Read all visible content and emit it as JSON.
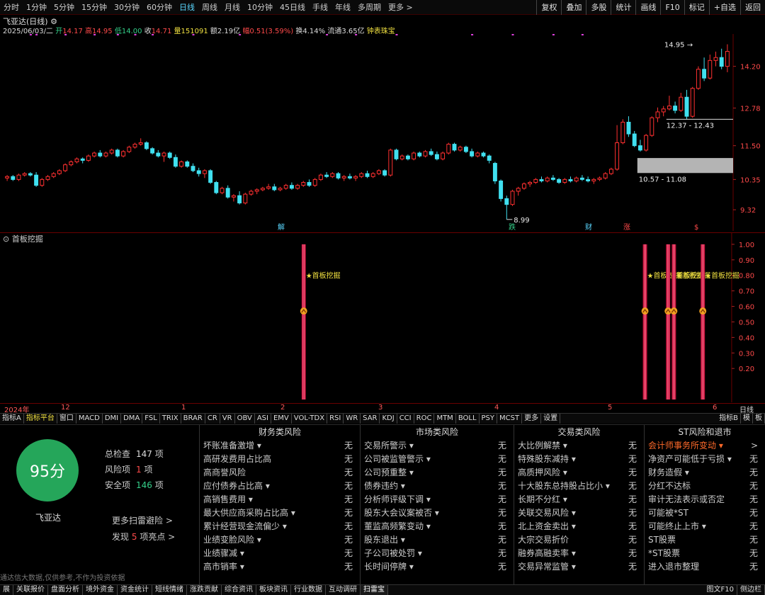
{
  "periods": [
    "分时",
    "1分钟",
    "5分钟",
    "15分钟",
    "30分钟",
    "60分钟",
    "日线",
    "周线",
    "月线",
    "10分钟",
    "45日线",
    "手线",
    "年线",
    "多周期",
    "更多 >"
  ],
  "period_active": "日线",
  "toolbar_right": [
    "复权",
    "叠加",
    "多股",
    "统计",
    "画线",
    "F10",
    "标记",
    "+自选",
    "返回"
  ],
  "title": "飞亚达(日线)",
  "quote": {
    "date": "2025/06/03/二",
    "open_label": "开",
    "open": "14.17",
    "high_label": "高",
    "high": "14.95",
    "low_label": "低",
    "low": "14.00",
    "close_label": "收",
    "close": "14.71",
    "vol_label": "量",
    "vol": "151091",
    "amt_label": "额",
    "amt": "2.19亿",
    "chg_label": "幅",
    "chg": "0.51(3.59%)",
    "turn_label": "换",
    "turn": "4.14%",
    "float_label": "流通",
    "float": "3.65亿",
    "extra": "钟表珠宝"
  },
  "price_axis": [
    "14.20",
    "12.78",
    "11.50",
    "10.35",
    "9.32"
  ],
  "annotations": {
    "high_mark": "14.95",
    "low_mark": "8.99",
    "zone1": "12.37 - 12.43",
    "zone2": "10.57 - 11.08"
  },
  "event_tags": [
    "解",
    "跌",
    "财",
    "涨",
    "$"
  ],
  "indicator": {
    "title": "首板挖掘",
    "axis": [
      "1.00",
      "0.90",
      "0.80",
      "0.70",
      "0.60",
      "0.50",
      "0.40",
      "0.30",
      "0.20"
    ],
    "signal_label": "★首板挖掘"
  },
  "time_axis": [
    "2024年",
    "12",
    "1",
    "2",
    "3",
    "4",
    "5",
    "6"
  ],
  "time_axis_right": "日线",
  "tabs": [
    "指标A",
    "指标平台",
    "窗口",
    "MACD",
    "DMI",
    "DMA",
    "FSL",
    "TRIX",
    "BRAR",
    "CR",
    "VR",
    "OBV",
    "ASI",
    "EMV",
    "VOL-TDX",
    "RSI",
    "WR",
    "SAR",
    "KDJ",
    "CCI",
    "ROC",
    "MTM",
    "BOLL",
    "PSY",
    "MCST",
    "更多",
    "设置"
  ],
  "tabs_right": [
    "指标B",
    "模",
    "板"
  ],
  "score": {
    "value": "95分",
    "name": "飞亚达",
    "total_label": "总检查",
    "total": "147",
    "total_unit": "项",
    "risk_label": "风险项",
    "risk": "1",
    "risk_unit": "项",
    "safe_label": "安全项",
    "safe": "146",
    "safe_unit": "项",
    "more": "更多扫雷避险 >",
    "found_pre": "发现",
    "found": "5",
    "found_post": "项亮点 >",
    "disclaimer": "通达信大数据,仅供参考,不作为投资依据"
  },
  "columns": [
    {
      "title": "财务类风险",
      "rows": [
        {
          "label": "坏账准备激增 ▾",
          "value": "无"
        },
        {
          "label": "高研发费用占比高",
          "value": "无"
        },
        {
          "label": "高商誉风险",
          "value": "无"
        },
        {
          "label": "应付债券占比高 ▾",
          "value": "无"
        },
        {
          "label": "高销售费用 ▾",
          "value": "无"
        },
        {
          "label": "最大供应商采购占比高 ▾",
          "value": "无"
        },
        {
          "label": "累计经营现金流偏少 ▾",
          "value": "无"
        },
        {
          "label": "业绩变脸风险 ▾",
          "value": "无"
        },
        {
          "label": "业绩骤减 ▾",
          "value": "无"
        },
        {
          "label": "高市销率 ▾",
          "value": "无"
        }
      ]
    },
    {
      "title": "市场类风险",
      "rows": [
        {
          "label": "交易所警示 ▾",
          "value": "无"
        },
        {
          "label": "公司被监管警示 ▾",
          "value": "无"
        },
        {
          "label": "公司预重整 ▾",
          "value": "无"
        },
        {
          "label": "债券违约 ▾",
          "value": "无"
        },
        {
          "label": "分析师评级下调 ▾",
          "value": "无"
        },
        {
          "label": "股东大会议案被否 ▾",
          "value": "无"
        },
        {
          "label": "董监高频繁变动 ▾",
          "value": "无"
        },
        {
          "label": "股东退出 ▾",
          "value": "无"
        },
        {
          "label": "子公司被处罚 ▾",
          "value": "无"
        },
        {
          "label": "长时间停牌 ▾",
          "value": "无"
        }
      ]
    },
    {
      "title": "交易类风险",
      "rows": [
        {
          "label": "大比例解禁 ▾",
          "value": "无"
        },
        {
          "label": "特殊股东减持 ▾",
          "value": "无"
        },
        {
          "label": "高质押风险 ▾",
          "value": "无"
        },
        {
          "label": "十大股东总持股占比小 ▾",
          "value": "无"
        },
        {
          "label": "长期不分红 ▾",
          "value": "无"
        },
        {
          "label": "关联交易风险 ▾",
          "value": "无"
        },
        {
          "label": "北上资金卖出 ▾",
          "value": "无"
        },
        {
          "label": "大宗交易折价",
          "value": "无"
        },
        {
          "label": "融券高融卖率 ▾",
          "value": "无"
        },
        {
          "label": "交易异常监管 ▾",
          "value": "无"
        }
      ]
    },
    {
      "title": "ST风险和退市",
      "rows": [
        {
          "label": "会计师事务所变动 ▾",
          "value": ">",
          "alert": true
        },
        {
          "label": "净资产可能低于亏损 ▾",
          "value": "无"
        },
        {
          "label": "财务造假 ▾",
          "value": "无"
        },
        {
          "label": "分红不达标",
          "value": "无"
        },
        {
          "label": "审计无法表示或否定",
          "value": "无"
        },
        {
          "label": "可能被*ST",
          "value": "无"
        },
        {
          "label": "可能终止上市 ▾",
          "value": "无"
        },
        {
          "label": "ST股票",
          "value": "无"
        },
        {
          "label": "*ST股票",
          "value": "无"
        },
        {
          "label": "进入退市整理",
          "value": "无"
        }
      ]
    }
  ],
  "statusbar": [
    "展",
    "关联报价",
    "盘面分析",
    "境外资金",
    "资金统计",
    "短线情绪",
    "涨跌贡献",
    "综合资讯",
    "板块资讯",
    "行业数据",
    "互动调研",
    "扫雷宝"
  ],
  "statusbar_active": "扫雷宝",
  "statusbar_right": [
    "图文F10",
    "侧边栏"
  ],
  "candles": [
    [
      10.4,
      10.5,
      10.3,
      10.45
    ],
    [
      10.45,
      10.5,
      10.3,
      10.35
    ],
    [
      10.35,
      10.55,
      10.3,
      10.5
    ],
    [
      10.5,
      10.6,
      10.45,
      10.55
    ],
    [
      10.55,
      10.6,
      10.45,
      10.5
    ],
    [
      10.5,
      10.6,
      10.1,
      10.15
    ],
    [
      10.15,
      10.4,
      10.1,
      10.35
    ],
    [
      10.35,
      10.5,
      10.3,
      10.45
    ],
    [
      10.45,
      10.6,
      10.4,
      10.55
    ],
    [
      10.55,
      10.7,
      10.5,
      10.65
    ],
    [
      10.65,
      10.9,
      10.6,
      10.85
    ],
    [
      10.85,
      11.0,
      10.8,
      10.95
    ],
    [
      10.95,
      11.1,
      10.9,
      11.05
    ],
    [
      11.05,
      11.1,
      10.9,
      11.0
    ],
    [
      11.0,
      11.2,
      10.95,
      11.15
    ],
    [
      11.15,
      11.3,
      11.1,
      11.25
    ],
    [
      11.25,
      11.35,
      11.1,
      11.15
    ],
    [
      11.15,
      11.3,
      11.1,
      11.25
    ],
    [
      11.25,
      11.4,
      11.2,
      11.35
    ],
    [
      11.35,
      11.4,
      11.1,
      11.15
    ],
    [
      11.15,
      11.35,
      11.1,
      11.3
    ],
    [
      11.3,
      11.5,
      11.25,
      11.45
    ],
    [
      11.45,
      11.6,
      11.4,
      11.55
    ],
    [
      11.55,
      11.75,
      11.5,
      11.6
    ],
    [
      11.6,
      11.65,
      11.35,
      11.4
    ],
    [
      11.4,
      11.45,
      11.2,
      11.25
    ],
    [
      11.25,
      11.35,
      11.1,
      11.15
    ],
    [
      11.15,
      11.3,
      10.95,
      11.25
    ],
    [
      11.25,
      11.3,
      11.05,
      11.1
    ],
    [
      11.1,
      11.2,
      10.75,
      10.8
    ],
    [
      10.8,
      11.0,
      10.75,
      10.95
    ],
    [
      10.95,
      11.0,
      10.75,
      10.8
    ],
    [
      10.8,
      10.9,
      10.6,
      10.65
    ],
    [
      10.65,
      10.75,
      10.45,
      10.55
    ],
    [
      10.55,
      10.7,
      10.4,
      10.65
    ],
    [
      10.65,
      10.7,
      10.2,
      10.25
    ],
    [
      10.25,
      10.3,
      9.85,
      9.9
    ],
    [
      9.9,
      10.1,
      9.85,
      10.05
    ],
    [
      10.05,
      10.15,
      9.7,
      9.75
    ],
    [
      9.75,
      9.85,
      9.6,
      9.8
    ],
    [
      9.8,
      9.95,
      9.5,
      9.55
    ],
    [
      9.55,
      9.9,
      9.5,
      9.85
    ],
    [
      9.85,
      10.0,
      9.8,
      9.95
    ],
    [
      9.95,
      10.05,
      9.85,
      10.0
    ],
    [
      10.0,
      10.1,
      9.95,
      10.05
    ],
    [
      10.05,
      10.2,
      10.0,
      10.1
    ],
    [
      10.1,
      10.2,
      9.95,
      10.0
    ],
    [
      10.0,
      10.1,
      9.95,
      10.05
    ],
    [
      10.05,
      10.2,
      10.0,
      10.15
    ],
    [
      10.15,
      10.25,
      10.0,
      10.05
    ],
    [
      10.05,
      10.2,
      10.0,
      10.15
    ],
    [
      10.15,
      10.3,
      10.1,
      10.25
    ],
    [
      10.25,
      10.35,
      10.1,
      10.15
    ],
    [
      10.15,
      10.4,
      10.1,
      10.35
    ],
    [
      10.35,
      10.55,
      10.3,
      10.5
    ],
    [
      10.5,
      10.6,
      10.4,
      10.45
    ],
    [
      10.45,
      10.6,
      10.4,
      10.55
    ],
    [
      10.55,
      10.6,
      10.35,
      10.4
    ],
    [
      10.4,
      10.5,
      10.3,
      10.45
    ],
    [
      10.45,
      10.55,
      10.35,
      10.4
    ],
    [
      10.4,
      10.5,
      10.3,
      10.45
    ],
    [
      10.45,
      10.6,
      10.4,
      10.55
    ],
    [
      10.55,
      10.65,
      10.4,
      10.45
    ],
    [
      10.45,
      10.6,
      10.4,
      10.55
    ],
    [
      10.55,
      10.7,
      10.5,
      10.65
    ],
    [
      10.65,
      10.7,
      10.45,
      10.5
    ],
    [
      10.5,
      11.4,
      10.45,
      11.35
    ],
    [
      11.35,
      11.4,
      11.0,
      11.05
    ],
    [
      11.05,
      11.2,
      11.0,
      11.15
    ],
    [
      11.15,
      11.2,
      11.0,
      11.05
    ],
    [
      11.05,
      11.3,
      11.0,
      11.25
    ],
    [
      11.25,
      11.3,
      11.1,
      11.15
    ],
    [
      11.15,
      11.35,
      11.1,
      11.3
    ],
    [
      11.3,
      11.4,
      11.15,
      11.2
    ],
    [
      11.2,
      11.3,
      11.0,
      11.05
    ],
    [
      11.05,
      11.3,
      11.0,
      11.25
    ],
    [
      11.25,
      11.6,
      11.2,
      11.55
    ],
    [
      11.55,
      11.6,
      11.3,
      11.35
    ],
    [
      11.35,
      11.5,
      11.3,
      11.45
    ],
    [
      11.45,
      11.5,
      11.25,
      11.3
    ],
    [
      11.3,
      11.4,
      11.1,
      11.15
    ],
    [
      11.15,
      11.3,
      11.1,
      11.25
    ],
    [
      11.25,
      11.3,
      11.1,
      11.15
    ],
    [
      11.15,
      11.2,
      10.9,
      11.0
    ],
    [
      10.9,
      10.95,
      10.2,
      10.3
    ],
    [
      10.3,
      10.35,
      9.6,
      9.7
    ],
    [
      9.7,
      9.8,
      8.99,
      9.5
    ],
    [
      9.5,
      10.0,
      9.45,
      9.95
    ],
    [
      9.95,
      10.1,
      9.8,
      10.05
    ],
    [
      10.05,
      10.25,
      10.0,
      10.2
    ],
    [
      10.2,
      10.3,
      10.1,
      10.25
    ],
    [
      10.25,
      10.4,
      10.2,
      10.35
    ],
    [
      10.35,
      10.45,
      10.25,
      10.3
    ],
    [
      10.3,
      10.45,
      10.25,
      10.4
    ],
    [
      10.4,
      10.5,
      10.3,
      10.35
    ],
    [
      10.35,
      10.4,
      10.2,
      10.25
    ],
    [
      10.25,
      10.4,
      10.2,
      10.35
    ],
    [
      10.35,
      10.45,
      10.25,
      10.3
    ],
    [
      10.3,
      10.45,
      10.25,
      10.4
    ],
    [
      10.4,
      10.5,
      10.3,
      10.35
    ],
    [
      10.35,
      10.45,
      10.25,
      10.3
    ],
    [
      10.3,
      10.4,
      10.2,
      10.35
    ],
    [
      10.35,
      10.45,
      10.3,
      10.4
    ],
    [
      10.4,
      10.6,
      10.35,
      10.55
    ],
    [
      10.55,
      10.75,
      10.5,
      10.7
    ],
    [
      10.7,
      12.2,
      10.65,
      11.6
    ],
    [
      11.6,
      12.4,
      11.55,
      12.3
    ],
    [
      12.3,
      12.5,
      11.8,
      11.9
    ],
    [
      11.9,
      12.0,
      11.45,
      11.5
    ],
    [
      11.5,
      11.7,
      11.3,
      11.35
    ],
    [
      11.35,
      11.9,
      11.3,
      11.85
    ],
    [
      11.85,
      12.5,
      11.8,
      12.45
    ],
    [
      12.45,
      12.8,
      12.3,
      12.65
    ],
    [
      12.65,
      12.85,
      12.5,
      12.75
    ],
    [
      12.75,
      13.2,
      12.7,
      12.85
    ],
    [
      12.85,
      13.0,
      12.6,
      12.7
    ],
    [
      12.7,
      13.3,
      12.65,
      13.15
    ],
    [
      13.15,
      13.4,
      12.4,
      12.5
    ],
    [
      12.5,
      13.5,
      12.45,
      13.45
    ],
    [
      13.45,
      14.2,
      13.4,
      14.1
    ],
    [
      14.1,
      14.5,
      13.7,
      13.8
    ],
    [
      13.8,
      14.6,
      13.75,
      14.4
    ],
    [
      14.4,
      14.7,
      14.2,
      14.5
    ],
    [
      14.5,
      14.8,
      14.1,
      14.2
    ],
    [
      14.2,
      14.95,
      14.0,
      14.71
    ]
  ],
  "signals": [
    51,
    110,
    114,
    115,
    120
  ]
}
